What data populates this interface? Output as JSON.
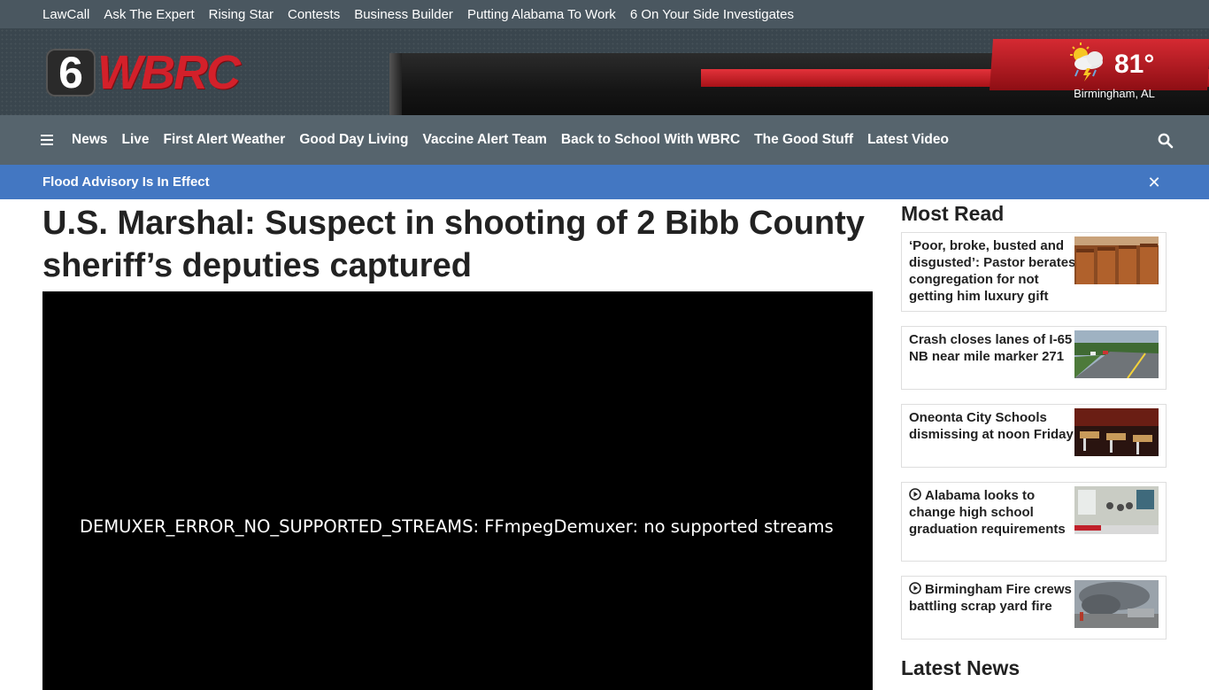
{
  "utility_nav": [
    "LawCall",
    "Ask The Expert",
    "Rising Star",
    "Contests",
    "Business Builder",
    "Putting Alabama To Work",
    "6 On Your Side Investigates"
  ],
  "header": {
    "logo_number": "6",
    "logo_text": "WBRC",
    "weather": {
      "temp": "81°",
      "location": "Birmingham, AL",
      "icon": "thunderstorm-cloud-icon"
    }
  },
  "main_nav": [
    "News",
    "Live",
    "First Alert Weather",
    "Good Day Living",
    "Vaccine Alert Team",
    "Back to School With WBRC",
    "The Good Stuff",
    "Latest Video"
  ],
  "alert": {
    "text": "Flood Advisory Is In Effect"
  },
  "article": {
    "headline": "U.S. Marshal: Suspect in shooting of 2 Bibb County sheriff’s deputies captured",
    "video_error": "DEMUXER_ERROR_NO_SUPPORTED_STREAMS: FFmpegDemuxer: no supported streams"
  },
  "sidebar": {
    "most_read_title": "Most Read",
    "latest_news_title": "Latest News",
    "items": [
      {
        "title": "‘Poor, broke, busted and disgusted’: Pastor berates congregation for not getting him luxury gift",
        "video": false
      },
      {
        "title": "Crash closes lanes of I-65 NB near mile marker 271",
        "video": false
      },
      {
        "title": "Oneonta City Schools dismissing at noon Friday",
        "video": false
      },
      {
        "title": "Alabama looks to change high school graduation requirements",
        "video": true
      },
      {
        "title": "Birmingham Fire crews battling scrap yard fire",
        "video": true
      }
    ]
  },
  "colors": {
    "alert_blue": "#4377c2",
    "nav_gray": "#56646d",
    "brand_red": "#d3202a"
  }
}
